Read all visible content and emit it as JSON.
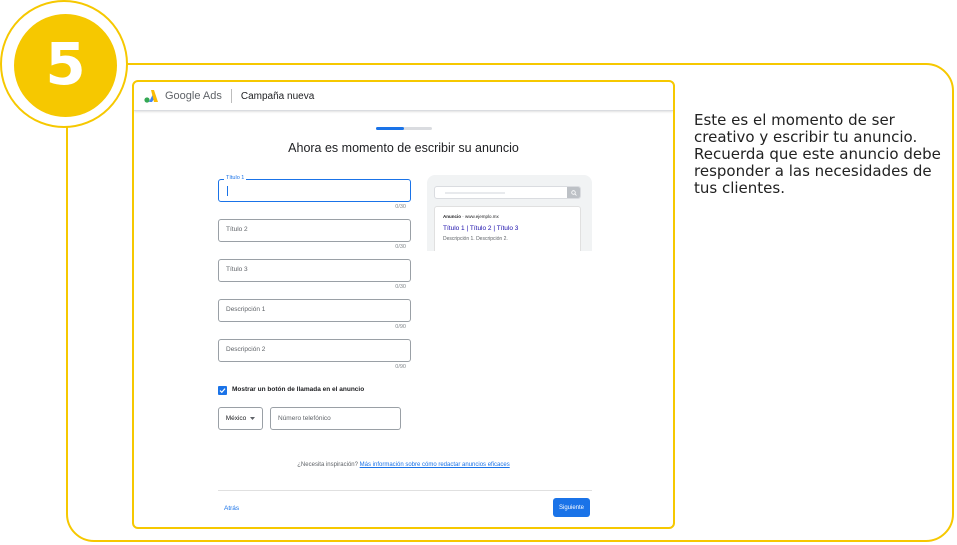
{
  "step": {
    "number": "5"
  },
  "side_text": "Este es el momento de ser creativo y escribir tu anuncio. Recuerda que este anuncio debe responder a las necesidades de tus clientes.",
  "header": {
    "brand": "Google Ads",
    "campaign": "Campaña nueva"
  },
  "progress": {
    "fraction": 0.5
  },
  "heading": "Ahora es momento de escribir su anuncio",
  "fields": [
    {
      "label": "Título 1",
      "counter": "0/30"
    },
    {
      "label": "Título 2",
      "counter": "0/30"
    },
    {
      "label": "Título 3",
      "counter": "0/30"
    },
    {
      "label": "Descripción 1",
      "counter": "0/90"
    },
    {
      "label": "Descripción 2",
      "counter": "0/90"
    }
  ],
  "call_button": {
    "label": "Mostrar un botón de llamada en el anuncio",
    "checked": true
  },
  "country_select": {
    "value": "México"
  },
  "phone": {
    "placeholder": "Número telefónico"
  },
  "preview": {
    "ad_tag": "Anuncio",
    "url": "· www.ejemplo.mx",
    "title": "Título 1 | Título 2 | Título 3",
    "description": "Descripción 1. Descripción 2."
  },
  "inspiration": {
    "question": "¿Necesita inspiración?",
    "link": "Más información sobre cómo redactar anuncios eficaces"
  },
  "footer": {
    "back_label": "Atrás",
    "next_label": "Siguiente"
  },
  "colors": {
    "accent_yellow": "#F6C800",
    "google_blue": "#1a73e8"
  }
}
